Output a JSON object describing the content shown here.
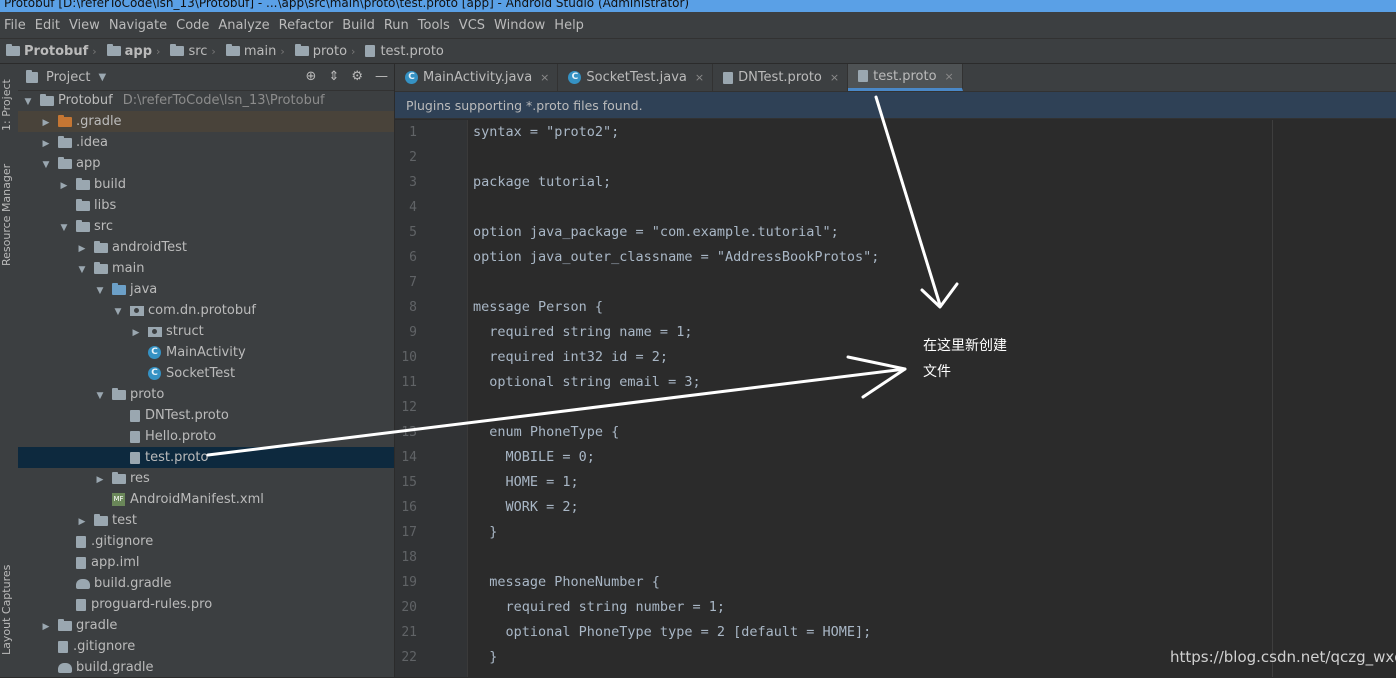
{
  "window": {
    "title": "Protobuf [D:\\referToCode\\lsn_13\\Protobuf] - ...\\app\\src\\main\\proto\\test.proto [app] - Android Studio (Administrator)"
  },
  "menu": [
    "File",
    "Edit",
    "View",
    "Navigate",
    "Code",
    "Analyze",
    "Refactor",
    "Build",
    "Run",
    "Tools",
    "VCS",
    "Window",
    "Help"
  ],
  "breadcrumb": [
    "Protobuf",
    "app",
    "src",
    "main",
    "proto",
    "test.proto"
  ],
  "left_toolbar": {
    "project_label": "1: Project",
    "resource_label": "Resource Manager",
    "captures_label": "Layout Captures"
  },
  "project_panel": {
    "title": "Project",
    "tree": [
      {
        "label": "Protobuf",
        "path": "D:\\referToCode\\lsn_13\\Protobuf",
        "depth": 0,
        "arrow": "down",
        "icon": "folder"
      },
      {
        "label": ".gradle",
        "depth": 1,
        "arrow": "right",
        "icon": "folder-orange",
        "hl": "orange"
      },
      {
        "label": ".idea",
        "depth": 1,
        "arrow": "right",
        "icon": "folder"
      },
      {
        "label": "app",
        "depth": 1,
        "arrow": "down",
        "icon": "folder"
      },
      {
        "label": "build",
        "depth": 2,
        "arrow": "right",
        "icon": "folder"
      },
      {
        "label": "libs",
        "depth": 2,
        "arrow": "none",
        "icon": "folder"
      },
      {
        "label": "src",
        "depth": 2,
        "arrow": "down",
        "icon": "folder"
      },
      {
        "label": "androidTest",
        "depth": 3,
        "arrow": "right",
        "icon": "folder"
      },
      {
        "label": "main",
        "depth": 3,
        "arrow": "down",
        "icon": "folder"
      },
      {
        "label": "java",
        "depth": 4,
        "arrow": "down",
        "icon": "folder-blue"
      },
      {
        "label": "com.dn.protobuf",
        "depth": 5,
        "arrow": "down",
        "icon": "package"
      },
      {
        "label": "struct",
        "depth": 6,
        "arrow": "right",
        "icon": "package"
      },
      {
        "label": "MainActivity",
        "depth": 6,
        "arrow": "none",
        "icon": "class"
      },
      {
        "label": "SocketTest",
        "depth": 6,
        "arrow": "none",
        "icon": "class"
      },
      {
        "label": "proto",
        "depth": 4,
        "arrow": "down",
        "icon": "folder"
      },
      {
        "label": "DNTest.proto",
        "depth": 5,
        "arrow": "none",
        "icon": "file"
      },
      {
        "label": "Hello.proto",
        "depth": 5,
        "arrow": "none",
        "icon": "file"
      },
      {
        "label": "test.proto",
        "depth": 5,
        "arrow": "none",
        "icon": "file",
        "hl": "selected"
      },
      {
        "label": "res",
        "depth": 4,
        "arrow": "right",
        "icon": "folder"
      },
      {
        "label": "AndroidManifest.xml",
        "depth": 4,
        "arrow": "none",
        "icon": "manifest"
      },
      {
        "label": "test",
        "depth": 3,
        "arrow": "right",
        "icon": "folder"
      },
      {
        "label": ".gitignore",
        "depth": 2,
        "arrow": "none",
        "icon": "file"
      },
      {
        "label": "app.iml",
        "depth": 2,
        "arrow": "none",
        "icon": "file"
      },
      {
        "label": "build.gradle",
        "depth": 2,
        "arrow": "none",
        "icon": "gradle"
      },
      {
        "label": "proguard-rules.pro",
        "depth": 2,
        "arrow": "none",
        "icon": "file"
      },
      {
        "label": "gradle",
        "depth": 1,
        "arrow": "right",
        "icon": "folder"
      },
      {
        "label": ".gitignore",
        "depth": 1,
        "arrow": "none",
        "icon": "file"
      },
      {
        "label": "build.gradle",
        "depth": 1,
        "arrow": "none",
        "icon": "gradle"
      }
    ]
  },
  "editor": {
    "tabs": [
      {
        "label": "MainActivity.java",
        "icon": "class",
        "active": false
      },
      {
        "label": "SocketTest.java",
        "icon": "class",
        "active": false
      },
      {
        "label": "DNTest.proto",
        "icon": "file",
        "active": false
      },
      {
        "label": "test.proto",
        "icon": "file",
        "active": true
      }
    ],
    "notice": "Plugins supporting *.proto files found.",
    "lines": [
      "syntax = \"proto2\";",
      "",
      "package tutorial;",
      "",
      "option java_package = \"com.example.tutorial\";",
      "option java_outer_classname = \"AddressBookProtos\";",
      "",
      "message Person {",
      "  required string name = 1;",
      "  required int32 id = 2;",
      "  optional string email = 3;",
      "",
      "  enum PhoneType {",
      "    MOBILE = 0;",
      "    HOME = 1;",
      "    WORK = 2;",
      "  }",
      "",
      "  message PhoneNumber {",
      "    required string number = 1;",
      "    optional PhoneType type = 2 [default = HOME];",
      "  }"
    ]
  },
  "annotation": {
    "line1": "在这里新创建",
    "line2": "文件"
  },
  "watermark": "https://blog.csdn.net/qczg_wxg",
  "colors": {
    "background": "#2b2b2b",
    "panel": "#3c3f41",
    "selected_row": "#0d293e",
    "tab_accent": "#4a88c7",
    "notice_bg": "#2f4156",
    "title_bar": "#5aa0e6"
  }
}
